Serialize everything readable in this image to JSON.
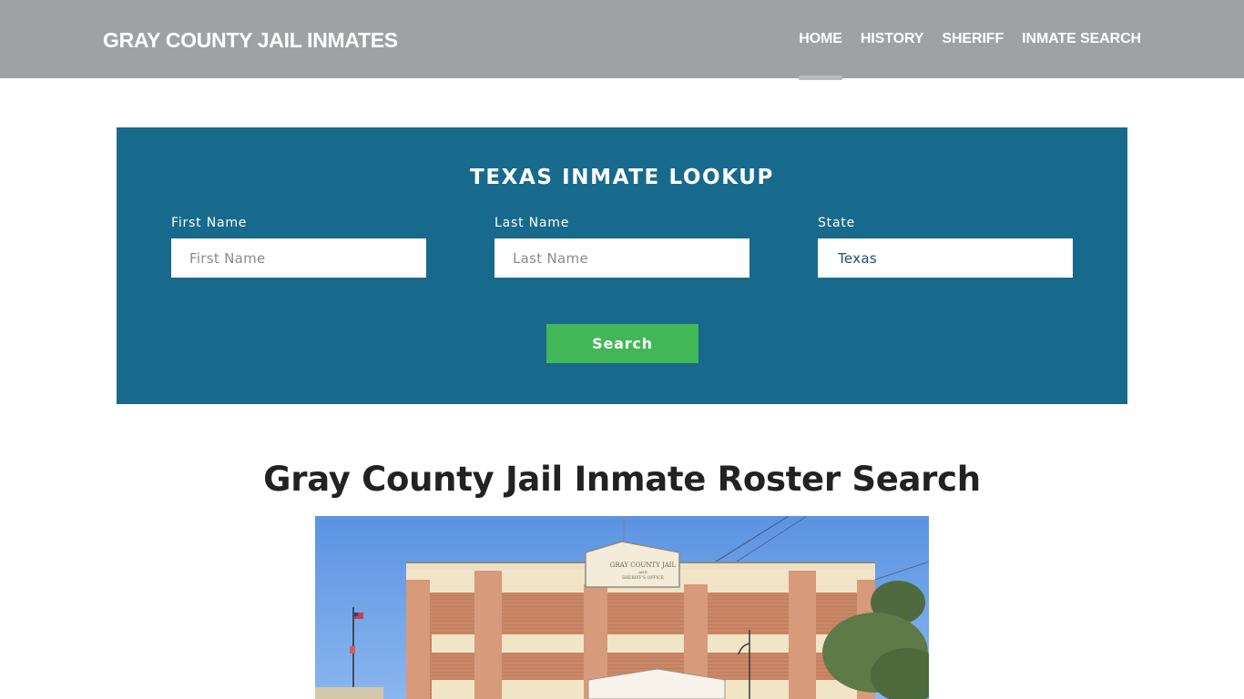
{
  "header": {
    "brand": "GRAY COUNTY JAIL INMATES",
    "nav": [
      {
        "label": "HOME",
        "active": true
      },
      {
        "label": "HISTORY",
        "active": false
      },
      {
        "label": "SHERIFF",
        "active": false
      },
      {
        "label": "INMATE SEARCH",
        "active": false
      }
    ]
  },
  "lookup": {
    "title": "TEXAS INMATE LOOKUP",
    "first_name": {
      "label": "First Name",
      "placeholder": "First Name",
      "value": ""
    },
    "last_name": {
      "label": "Last Name",
      "placeholder": "Last Name",
      "value": ""
    },
    "state": {
      "label": "State",
      "value": "Texas"
    },
    "search_label": "Search"
  },
  "main": {
    "title": "Gray County Jail Inmate Roster Search",
    "image": {
      "alt": "Gray County Jail and Sheriff's Office building",
      "sign_line1": "GRAY COUNTY JAIL",
      "sign_line2": "AND",
      "sign_line3": "SHERIFF'S OFFICE"
    }
  },
  "colors": {
    "navbar": "#9ea2a5",
    "lookup_bg": "#186a8d",
    "search_button": "#43b757"
  }
}
